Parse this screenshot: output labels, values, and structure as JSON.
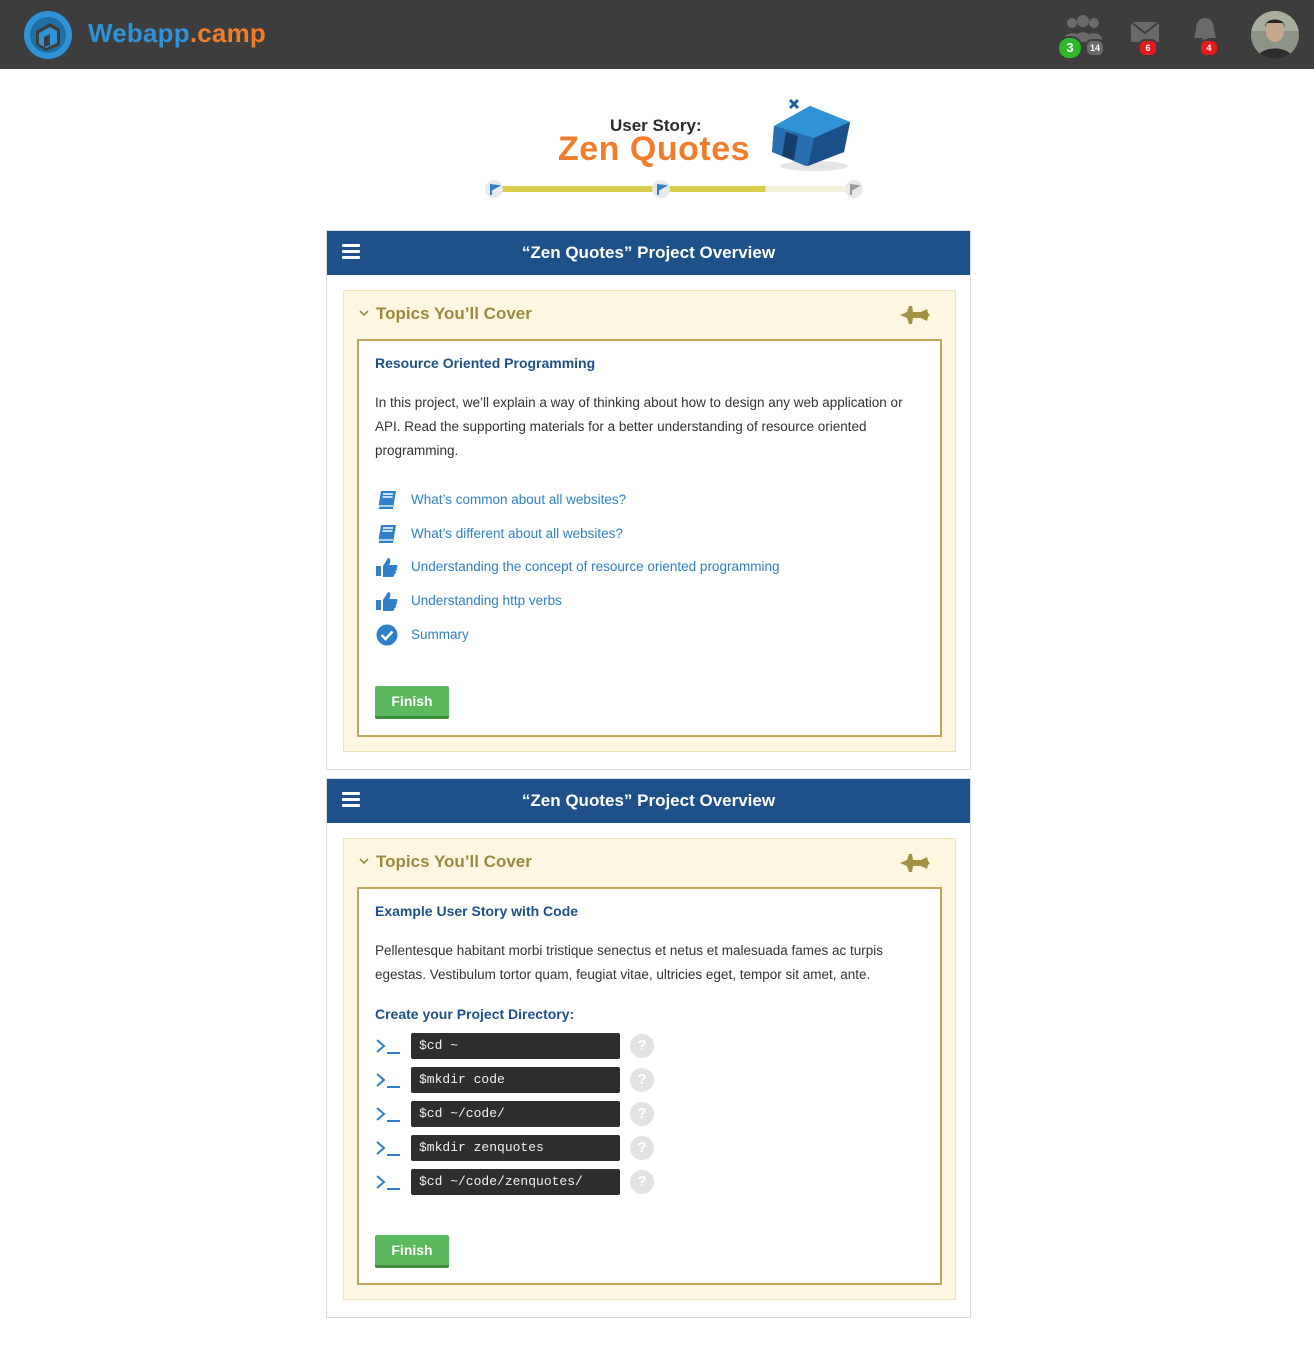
{
  "header": {
    "brand_part1": "Webapp",
    "brand_part2": ".camp",
    "friends_online_count": "3",
    "friends_count": "14",
    "messages_count": "6",
    "notifications_count": "4",
    "icons": [
      "home-cube-logo",
      "friends-icon",
      "mail-icon",
      "bell-icon",
      "user-avatar"
    ]
  },
  "hero": {
    "label": "User Story:",
    "title": "Zen Quotes",
    "progress_fraction": 0.75
  },
  "panels": [
    {
      "title": "“Zen Quotes” Project Overview",
      "accordion_title": "Topics You’ll Cover",
      "section_title": "Resource Oriented Programming",
      "paragraph": "In this project, we’ll explain a way of thinking about how to design any web application or API. Read the supporting materials for a better understanding of resource oriented programming.",
      "links": [
        {
          "icon": "book-icon",
          "label": "What’s common about all websites?"
        },
        {
          "icon": "book-icon",
          "label": "What’s different about all websites?"
        },
        {
          "icon": "thumbs-up-icon",
          "label": "Understanding the concept of resource oriented programming"
        },
        {
          "icon": "thumbs-up-icon",
          "label": "Understanding http verbs"
        },
        {
          "icon": "check-circle-icon",
          "label": "Summary"
        }
      ],
      "finish_label": "Finish"
    },
    {
      "title": "“Zen Quotes” Project Overview",
      "accordion_title": "Topics You’ll Cover",
      "section_title": "Example User Story with Code",
      "paragraph": "Pellentesque habitant morbi tristique senectus et netus et malesuada fames ac turpis egestas. Vestibulum tortor quam, feugiat vitae, ultricies eget, tempor sit amet, ante.",
      "subheading": "Create your Project Directory:",
      "commands": [
        "$cd ~",
        "$mkdir code",
        "$cd ~/code/",
        "$mkdir zenquotes",
        "$cd ~/code/zenquotes/"
      ],
      "help_glyph": "?",
      "finish_label": "Finish"
    }
  ],
  "colors": {
    "topbar": "#3d3d3d",
    "brand_blue": "#2f93d6",
    "brand_orange": "#f07d2c",
    "panel_header": "#1e5189",
    "accordion_bg": "#fdf7e2",
    "accordion_text": "#9b8a3e",
    "content_border": "#bfa75a",
    "link": "#2f80c8",
    "finish": "#5cb85c"
  }
}
